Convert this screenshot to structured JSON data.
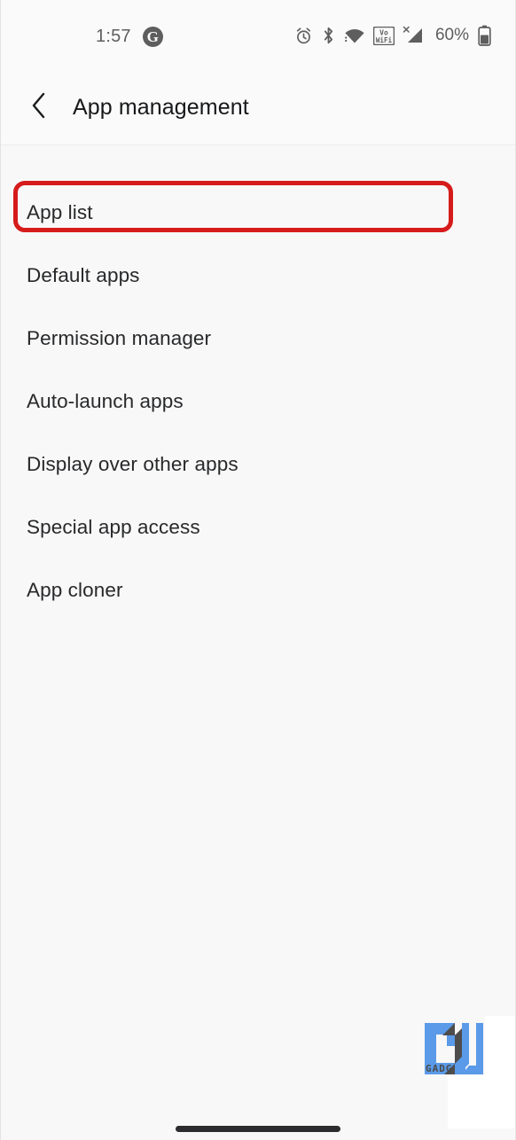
{
  "status_bar": {
    "time": "1:57",
    "google_icon": "G",
    "icons": [
      "alarm-icon",
      "bluetooth-icon",
      "wifi-icon",
      "vowifi-icon",
      "cellular-signal-icon"
    ],
    "battery_percent": "60%",
    "battery_icon": "battery-icon"
  },
  "app_bar": {
    "back_icon": "chevron-left-icon",
    "title": "App management"
  },
  "list": {
    "items": [
      {
        "label": "App list",
        "highlighted": true
      },
      {
        "label": "Default apps",
        "highlighted": false
      },
      {
        "label": "Permission manager",
        "highlighted": false
      },
      {
        "label": "Auto-launch apps",
        "highlighted": false
      },
      {
        "label": "Display over other apps",
        "highlighted": false
      },
      {
        "label": "Special app access",
        "highlighted": false
      },
      {
        "label": "App cloner",
        "highlighted": false
      }
    ]
  },
  "annotation": {
    "highlight_color": "#d61b1b",
    "target": "App list"
  },
  "watermark": {
    "logo_text": "GU",
    "caption": "GADG",
    "brand_color": "#5a9ae8",
    "dark_color": "#4d4d4d"
  },
  "navigation": {
    "home_indicator": "home-indicator"
  },
  "theme": {
    "background": "#f8f8f8",
    "surface": "#fafafa",
    "text_primary": "#28292b",
    "text_secondary": "#5e5e5e",
    "divider": "#ececec"
  }
}
